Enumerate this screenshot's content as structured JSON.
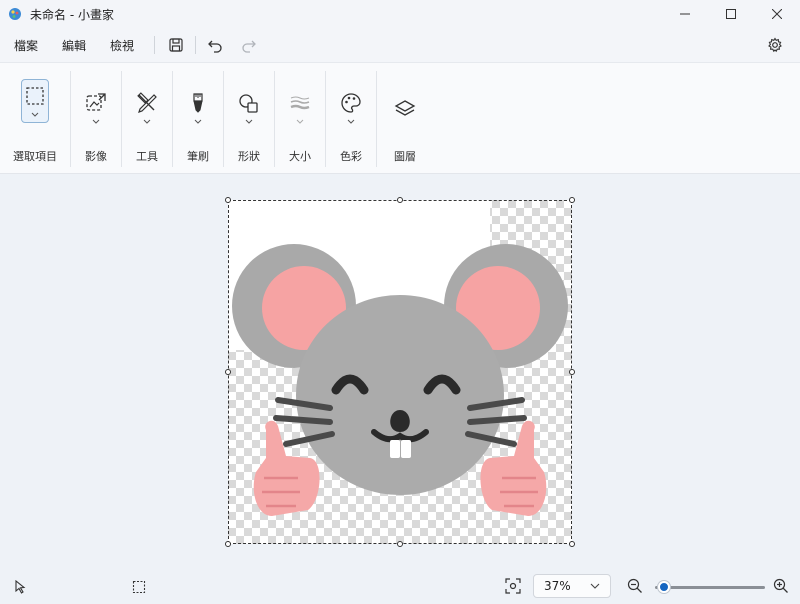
{
  "window": {
    "title": "未命名 - 小畫家",
    "app_icon": "paint-palette-icon",
    "controls": [
      "minimize-icon",
      "maximize-icon",
      "close-icon"
    ]
  },
  "menu": {
    "items": [
      "檔案",
      "編輯",
      "檢視"
    ],
    "tools": [
      "save-icon",
      "undo-icon",
      "redo-icon"
    ],
    "settings_icon": "gear-icon"
  },
  "ribbon": {
    "groups": [
      {
        "label": "選取項目",
        "icon": "selection-rectangle-icon",
        "selected": true
      },
      {
        "label": "影像",
        "icon": "image-crop-icon"
      },
      {
        "label": "工具",
        "icon": "tools-pencil-icon"
      },
      {
        "label": "筆刷",
        "icon": "brush-icon"
      },
      {
        "label": "形狀",
        "icon": "shapes-icon"
      },
      {
        "label": "大小",
        "icon": "line-size-icon"
      },
      {
        "label": "色彩",
        "icon": "palette-icon"
      },
      {
        "label": "圖層",
        "icon": "layers-icon"
      }
    ]
  },
  "canvas": {
    "content": "mouse-emoji-thumbs-up",
    "transparent_background": true
  },
  "status": {
    "zoom": "37%",
    "zoom_level": 0.02,
    "icons": [
      "pointer-icon",
      "selection-size-icon",
      "fit-screen-icon",
      "zoom-out-icon",
      "zoom-in-icon"
    ]
  },
  "colors": {
    "accent": "#1565c0",
    "mouse_gray": "#a9a9a9",
    "ear_pink": "#f6a3a3",
    "hand_pink": "#f5a8a8"
  }
}
